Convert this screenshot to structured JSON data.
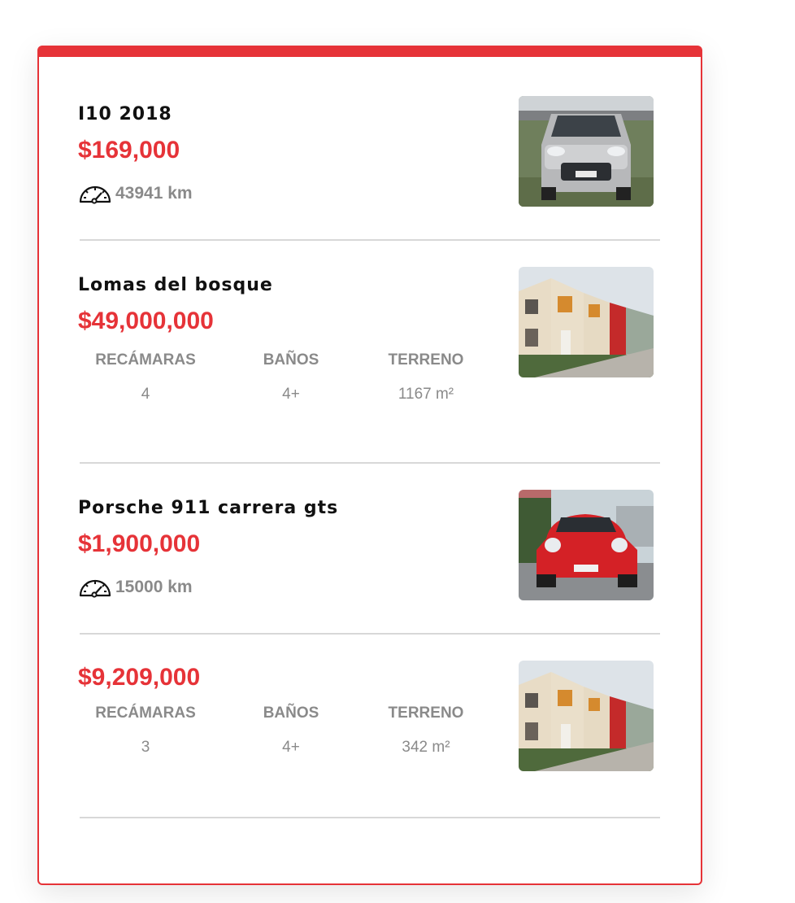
{
  "listings": [
    {
      "title": "I10 2018",
      "price": "$169,000",
      "km": "43941 km",
      "thumbnail_icon": "car-photo-silver-hatchback"
    },
    {
      "title": "Lomas del bosque",
      "price": "$49,000,000",
      "specs": [
        {
          "label": "RECÁMARAS",
          "value": "4"
        },
        {
          "label": "BAÑOS",
          "value": "4+"
        },
        {
          "label": "TERRENO",
          "value": "1167 m²"
        }
      ],
      "thumbnail_icon": "house-photo-townhouses"
    },
    {
      "title": "Porsche 911 carrera gts",
      "price": "$1,900,000",
      "km": "15000 km",
      "thumbnail_icon": "car-photo-red-porsche"
    },
    {
      "price": "$9,209,000",
      "specs": [
        {
          "label": "RECÁMARAS",
          "value": "3"
        },
        {
          "label": "BAÑOS",
          "value": "4+"
        },
        {
          "label": "TERRENO",
          "value": "342 m²"
        }
      ],
      "thumbnail_icon": "house-photo-townhouses"
    }
  ],
  "colors": {
    "accent": "#e63338",
    "title": "#111111",
    "muted": "#8a8a8a",
    "divider": "#d8d8d8"
  }
}
